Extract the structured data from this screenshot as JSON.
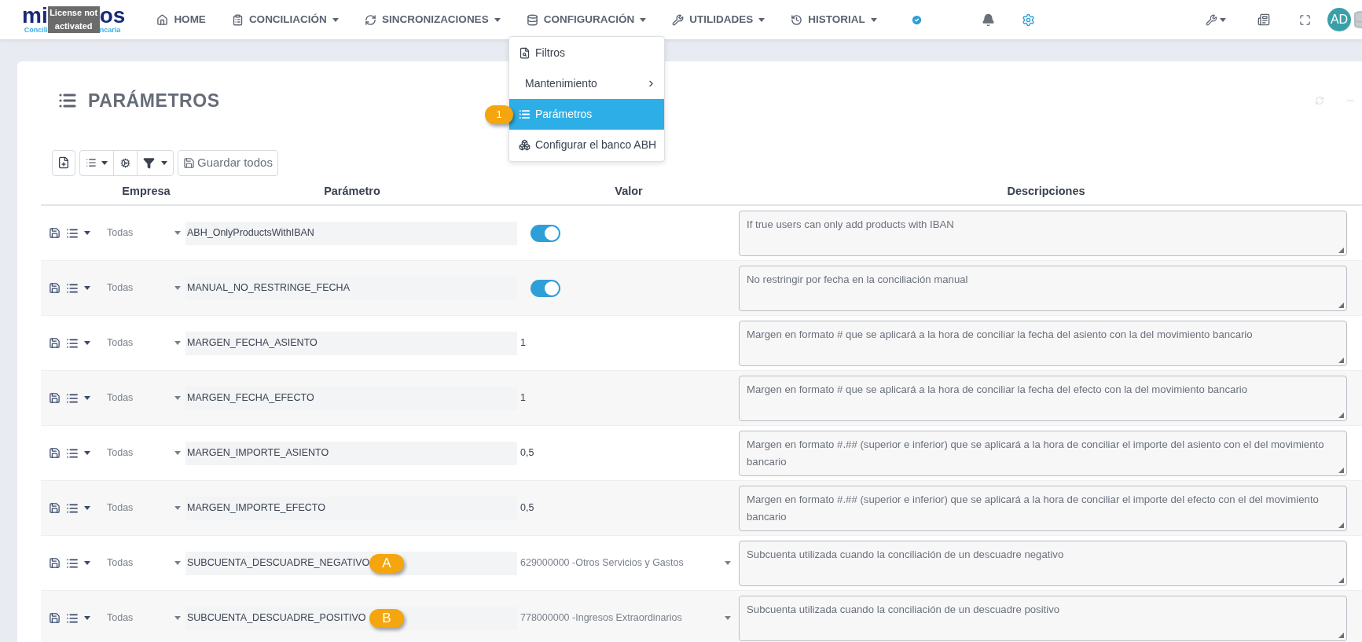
{
  "logo": {
    "name_start": "mi",
    "name_end": "os",
    "tagline_start": "Concili",
    "tagline_end": "ncaria",
    "overlay": "License not activated"
  },
  "nav": [
    {
      "label": "HOME",
      "caret": false
    },
    {
      "label": "CONCILIACIÓN",
      "caret": true
    },
    {
      "label": "SINCRONIZACIONES",
      "caret": true
    },
    {
      "label": "CONFIGURACIÓN",
      "caret": true
    },
    {
      "label": "UTILIDADES",
      "caret": true
    },
    {
      "label": "HISTORIAL",
      "caret": true
    }
  ],
  "user": {
    "initials": "AD"
  },
  "menu": {
    "items": [
      {
        "label": "Filtros",
        "submenu": false,
        "selected": false
      },
      {
        "label": "Mantenimiento",
        "submenu": true,
        "selected": false
      },
      {
        "label": "Parámetros",
        "submenu": false,
        "selected": true,
        "callout": "1"
      },
      {
        "label": "Configurar el banco ABH",
        "submenu": false,
        "selected": false
      }
    ]
  },
  "page": {
    "title": "PARÁMETROS"
  },
  "toolbar": {
    "save_all": "Guardar todos"
  },
  "table": {
    "columns": [
      "Empresa",
      "Parámetro",
      "Valor",
      "Descripciones"
    ],
    "rows": [
      {
        "empresa": "Todas",
        "parametro": "ABH_OnlyProductsWithIBAN",
        "valor": {
          "kind": "toggle",
          "on": true
        },
        "descripcion": "If true users can only add products with IBAN"
      },
      {
        "empresa": "Todas",
        "parametro": "MANUAL_NO_RESTRINGE_FECHA",
        "valor": {
          "kind": "toggle",
          "on": true
        },
        "descripcion": "No restringir por fecha en la conciliación manual"
      },
      {
        "empresa": "Todas",
        "parametro": "MARGEN_FECHA_ASIENTO",
        "valor": {
          "kind": "text",
          "text": "1"
        },
        "descripcion": "Margen en formato # que se aplicará a la hora de conciliar la fecha del asiento con la del movimiento bancario"
      },
      {
        "empresa": "Todas",
        "parametro": "MARGEN_FECHA_EFECTO",
        "valor": {
          "kind": "text",
          "text": "1"
        },
        "descripcion": "Margen en formato # que se aplicará a la hora de conciliar la fecha del efecto con la del movimiento bancario"
      },
      {
        "empresa": "Todas",
        "parametro": "MARGEN_IMPORTE_ASIENTO",
        "valor": {
          "kind": "text",
          "text": "0,5"
        },
        "descripcion": "Margen en formato #.## (superior e inferior) que se aplicará a la hora de conciliar el importe del asiento con el del movimiento bancario"
      },
      {
        "empresa": "Todas",
        "parametro": "MARGEN_IMPORTE_EFECTO",
        "valor": {
          "kind": "text",
          "text": "0,5"
        },
        "descripcion": "Margen en formato #.## (superior e inferior) que se aplicará a la hora de conciliar el importe del efecto con el del movimiento bancario"
      },
      {
        "empresa": "Todas",
        "parametro": "SUBCUENTA_DESCUADRE_NEGATIVO",
        "callout": "A",
        "valor": {
          "kind": "select",
          "text": "629000000 -Otros Servicios y Gastos"
        },
        "descripcion": "Subcuenta utilizada cuando la conciliación de un descuadre negativo"
      },
      {
        "empresa": "Todas",
        "parametro": "SUBCUENTA_DESCUADRE_POSITIVO",
        "callout": "B",
        "valor": {
          "kind": "select",
          "text": "778000000 -Ingresos Extraordinarios"
        },
        "descripcion": "Subcuenta utilizada cuando la conciliación de un descuadre positivo"
      }
    ]
  }
}
